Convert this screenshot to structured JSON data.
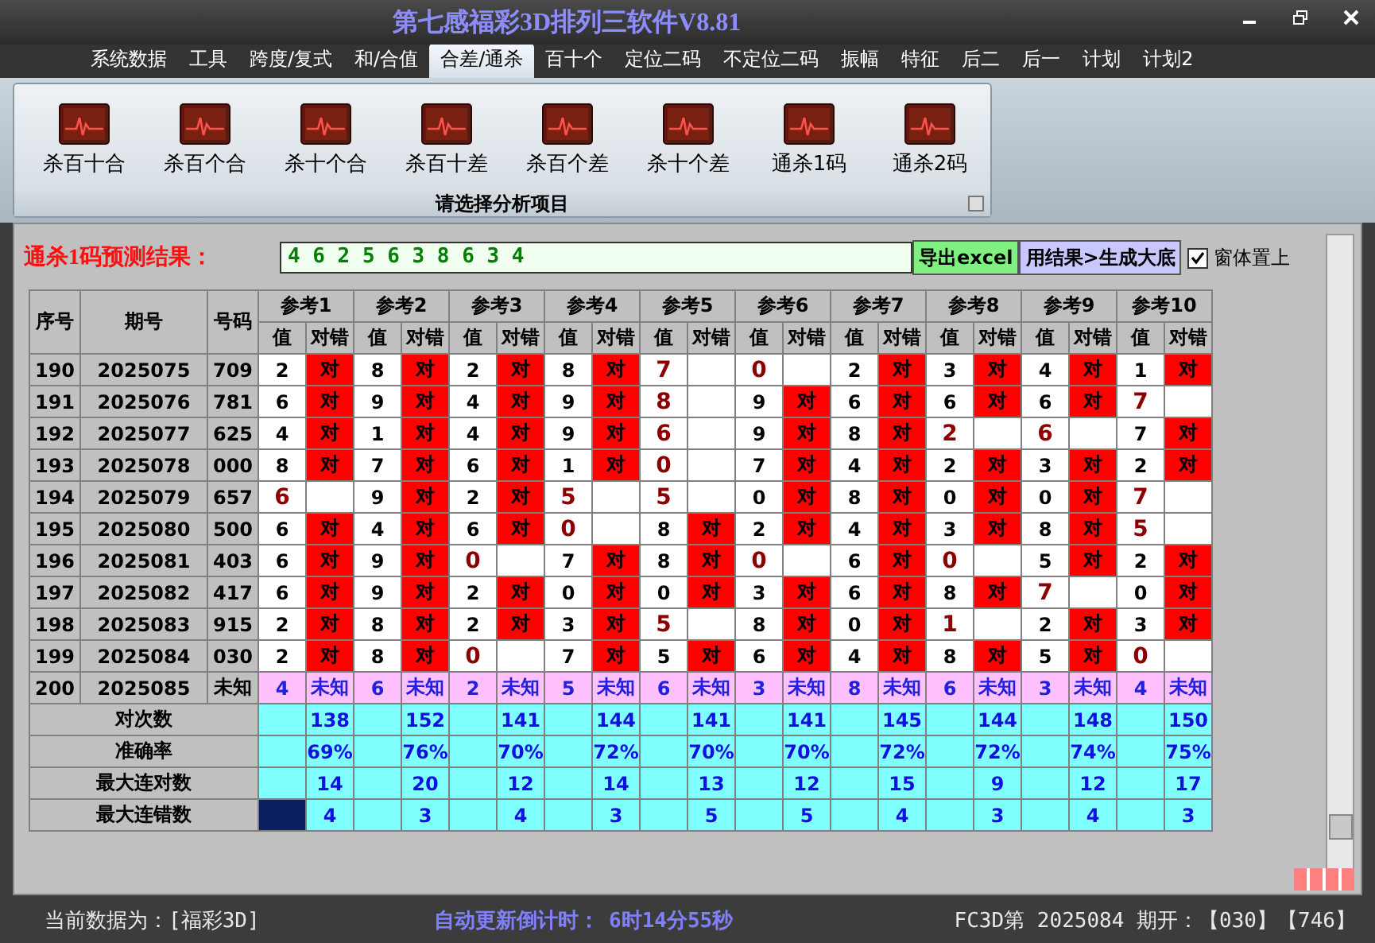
{
  "window": {
    "title": "第七感福彩3D排列三软件V8.81"
  },
  "menu": [
    {
      "label": "系统数据",
      "selected": false
    },
    {
      "label": "工具",
      "selected": false
    },
    {
      "label": "跨度/复式",
      "selected": false
    },
    {
      "label": "和/合值",
      "selected": false
    },
    {
      "label": "合差/通杀",
      "selected": true
    },
    {
      "label": "百十个",
      "selected": false
    },
    {
      "label": "定位二码",
      "selected": false
    },
    {
      "label": "不定位二码",
      "selected": false
    },
    {
      "label": "振幅",
      "selected": false
    },
    {
      "label": "特征",
      "selected": false
    },
    {
      "label": "后二",
      "selected": false
    },
    {
      "label": "后一",
      "selected": false
    },
    {
      "label": "计划",
      "selected": false
    },
    {
      "label": "计划2",
      "selected": false
    }
  ],
  "ribbon": {
    "group_label": "请选择分析项目",
    "items": [
      "杀百十合",
      "杀百个合",
      "杀十个合",
      "杀百十差",
      "杀百个差",
      "杀十个差",
      "通杀1码",
      "通杀2码"
    ]
  },
  "prediction": {
    "label": "通杀1码预测结果：",
    "value": "4 6 2 5 6 3 8 6 3 4",
    "buttons": [
      {
        "label": "导出excel",
        "kind": "export"
      },
      {
        "label": "用结果>生成大底",
        "kind": "generate"
      }
    ],
    "always_on_top": {
      "label": "窗体置上",
      "checked": true
    }
  },
  "table": {
    "columns": [
      "序号",
      "期号",
      "号码"
    ],
    "refs": [
      {
        "label": "参考1",
        "sub": [
          "值",
          "对错"
        ]
      },
      {
        "label": "参考2",
        "sub": [
          "值",
          "对错"
        ]
      },
      {
        "label": "参考3",
        "sub": [
          "值",
          "对错"
        ]
      },
      {
        "label": "参考4",
        "sub": [
          "值",
          "对错"
        ]
      },
      {
        "label": "参考5",
        "sub": [
          "值",
          "对错"
        ]
      },
      {
        "label": "参考6",
        "sub": [
          "值",
          "对错"
        ]
      },
      {
        "label": "参考7",
        "sub": [
          "值",
          "对错"
        ]
      },
      {
        "label": "参考8",
        "sub": [
          "值",
          "对错"
        ]
      },
      {
        "label": "参考9",
        "sub": [
          "值",
          "对错"
        ]
      },
      {
        "label": "参考10",
        "sub": [
          "值",
          "对错"
        ]
      }
    ],
    "rows": [
      {
        "kind": "done",
        "seq": "190",
        "period": "2025075",
        "number": "709",
        "refs": [
          {
            "value": "2",
            "hit": true,
            "mark": "对"
          },
          {
            "value": "8",
            "hit": true,
            "mark": "对"
          },
          {
            "value": "2",
            "hit": true,
            "mark": "对"
          },
          {
            "value": "8",
            "hit": true,
            "mark": "对"
          },
          {
            "value": "7",
            "hit": false
          },
          {
            "value": "0",
            "hit": false
          },
          {
            "value": "2",
            "hit": true,
            "mark": "对"
          },
          {
            "value": "3",
            "hit": true,
            "mark": "对"
          },
          {
            "value": "4",
            "hit": true,
            "mark": "对"
          },
          {
            "value": "1",
            "hit": true,
            "mark": "对"
          }
        ]
      },
      {
        "kind": "done",
        "seq": "191",
        "period": "2025076",
        "number": "781",
        "refs": [
          {
            "value": "6",
            "hit": true,
            "mark": "对"
          },
          {
            "value": "9",
            "hit": true,
            "mark": "对"
          },
          {
            "value": "4",
            "hit": true,
            "mark": "对"
          },
          {
            "value": "9",
            "hit": true,
            "mark": "对"
          },
          {
            "value": "8",
            "hit": false
          },
          {
            "value": "9",
            "hit": true,
            "mark": "对"
          },
          {
            "value": "6",
            "hit": true,
            "mark": "对"
          },
          {
            "value": "6",
            "hit": true,
            "mark": "对"
          },
          {
            "value": "6",
            "hit": true,
            "mark": "对"
          },
          {
            "value": "7",
            "hit": false
          }
        ]
      },
      {
        "kind": "done",
        "seq": "192",
        "period": "2025077",
        "number": "625",
        "refs": [
          {
            "value": "4",
            "hit": true,
            "mark": "对"
          },
          {
            "value": "1",
            "hit": true,
            "mark": "对"
          },
          {
            "value": "4",
            "hit": true,
            "mark": "对"
          },
          {
            "value": "9",
            "hit": true,
            "mark": "对"
          },
          {
            "value": "6",
            "hit": false
          },
          {
            "value": "9",
            "hit": true,
            "mark": "对"
          },
          {
            "value": "8",
            "hit": true,
            "mark": "对"
          },
          {
            "value": "2",
            "hit": false
          },
          {
            "value": "6",
            "hit": false
          },
          {
            "value": "7",
            "hit": true,
            "mark": "对"
          }
        ]
      },
      {
        "kind": "done",
        "seq": "193",
        "period": "2025078",
        "number": "000",
        "refs": [
          {
            "value": "8",
            "hit": true,
            "mark": "对"
          },
          {
            "value": "7",
            "hit": true,
            "mark": "对"
          },
          {
            "value": "6",
            "hit": true,
            "mark": "对"
          },
          {
            "value": "1",
            "hit": true,
            "mark": "对"
          },
          {
            "value": "0",
            "hit": false
          },
          {
            "value": "7",
            "hit": true,
            "mark": "对"
          },
          {
            "value": "4",
            "hit": true,
            "mark": "对"
          },
          {
            "value": "2",
            "hit": true,
            "mark": "对"
          },
          {
            "value": "3",
            "hit": true,
            "mark": "对"
          },
          {
            "value": "2",
            "hit": true,
            "mark": "对"
          }
        ]
      },
      {
        "kind": "done",
        "seq": "194",
        "period": "2025079",
        "number": "657",
        "refs": [
          {
            "value": "6",
            "hit": false
          },
          {
            "value": "9",
            "hit": true,
            "mark": "对"
          },
          {
            "value": "2",
            "hit": true,
            "mark": "对"
          },
          {
            "value": "5",
            "hit": false
          },
          {
            "value": "5",
            "hit": false
          },
          {
            "value": "0",
            "hit": true,
            "mark": "对"
          },
          {
            "value": "8",
            "hit": true,
            "mark": "对"
          },
          {
            "value": "0",
            "hit": true,
            "mark": "对"
          },
          {
            "value": "0",
            "hit": true,
            "mark": "对"
          },
          {
            "value": "7",
            "hit": false
          }
        ]
      },
      {
        "kind": "done",
        "seq": "195",
        "period": "2025080",
        "number": "500",
        "refs": [
          {
            "value": "6",
            "hit": true,
            "mark": "对"
          },
          {
            "value": "4",
            "hit": true,
            "mark": "对"
          },
          {
            "value": "6",
            "hit": true,
            "mark": "对"
          },
          {
            "value": "0",
            "hit": false
          },
          {
            "value": "8",
            "hit": true,
            "mark": "对"
          },
          {
            "value": "2",
            "hit": true,
            "mark": "对"
          },
          {
            "value": "4",
            "hit": true,
            "mark": "对"
          },
          {
            "value": "3",
            "hit": true,
            "mark": "对"
          },
          {
            "value": "8",
            "hit": true,
            "mark": "对"
          },
          {
            "value": "5",
            "hit": false
          }
        ]
      },
      {
        "kind": "done",
        "seq": "196",
        "period": "2025081",
        "number": "403",
        "refs": [
          {
            "value": "6",
            "hit": true,
            "mark": "对"
          },
          {
            "value": "9",
            "hit": true,
            "mark": "对"
          },
          {
            "value": "0",
            "hit": false
          },
          {
            "value": "7",
            "hit": true,
            "mark": "对"
          },
          {
            "value": "8",
            "hit": true,
            "mark": "对"
          },
          {
            "value": "0",
            "hit": false
          },
          {
            "value": "6",
            "hit": true,
            "mark": "对"
          },
          {
            "value": "0",
            "hit": false
          },
          {
            "value": "5",
            "hit": true,
            "mark": "对"
          },
          {
            "value": "2",
            "hit": true,
            "mark": "对"
          }
        ]
      },
      {
        "kind": "done",
        "seq": "197",
        "period": "2025082",
        "number": "417",
        "refs": [
          {
            "value": "6",
            "hit": true,
            "mark": "对"
          },
          {
            "value": "9",
            "hit": true,
            "mark": "对"
          },
          {
            "value": "2",
            "hit": true,
            "mark": "对"
          },
          {
            "value": "0",
            "hit": true,
            "mark": "对"
          },
          {
            "value": "0",
            "hit": true,
            "mark": "对"
          },
          {
            "value": "3",
            "hit": true,
            "mark": "对"
          },
          {
            "value": "6",
            "hit": true,
            "mark": "对"
          },
          {
            "value": "8",
            "hit": true,
            "mark": "对"
          },
          {
            "value": "7",
            "hit": false
          },
          {
            "value": "0",
            "hit": true,
            "mark": "对"
          }
        ]
      },
      {
        "kind": "done",
        "seq": "198",
        "period": "2025083",
        "number": "915",
        "refs": [
          {
            "value": "2",
            "hit": true,
            "mark": "对"
          },
          {
            "value": "8",
            "hit": true,
            "mark": "对"
          },
          {
            "value": "2",
            "hit": true,
            "mark": "对"
          },
          {
            "value": "3",
            "hit": true,
            "mark": "对"
          },
          {
            "value": "5",
            "hit": false
          },
          {
            "value": "8",
            "hit": true,
            "mark": "对"
          },
          {
            "value": "0",
            "hit": true,
            "mark": "对"
          },
          {
            "value": "1",
            "hit": false
          },
          {
            "value": "2",
            "hit": true,
            "mark": "对"
          },
          {
            "value": "3",
            "hit": true,
            "mark": "对"
          }
        ]
      },
      {
        "kind": "done",
        "seq": "199",
        "period": "2025084",
        "number": "030",
        "refs": [
          {
            "value": "2",
            "hit": true,
            "mark": "对"
          },
          {
            "value": "8",
            "hit": true,
            "mark": "对"
          },
          {
            "value": "0",
            "hit": false
          },
          {
            "value": "7",
            "hit": true,
            "mark": "对"
          },
          {
            "value": "5",
            "hit": true,
            "mark": "对"
          },
          {
            "value": "6",
            "hit": true,
            "mark": "对"
          },
          {
            "value": "4",
            "hit": true,
            "mark": "对"
          },
          {
            "value": "8",
            "hit": true,
            "mark": "对"
          },
          {
            "value": "5",
            "hit": true,
            "mark": "对"
          },
          {
            "value": "0",
            "hit": false
          }
        ]
      },
      {
        "kind": "pending",
        "seq": "200",
        "period": "2025085",
        "number": "未知",
        "refs": [
          {
            "value": "4",
            "mark": "未知"
          },
          {
            "value": "6",
            "mark": "未知"
          },
          {
            "value": "2",
            "mark": "未知"
          },
          {
            "value": "5",
            "mark": "未知"
          },
          {
            "value": "6",
            "mark": "未知"
          },
          {
            "value": "3",
            "mark": "未知"
          },
          {
            "value": "8",
            "mark": "未知"
          },
          {
            "value": "6",
            "mark": "未知"
          },
          {
            "value": "3",
            "mark": "未知"
          },
          {
            "value": "4",
            "mark": "未知"
          }
        ]
      }
    ],
    "stats": [
      {
        "label": "对次数",
        "selected": false,
        "values": [
          "138",
          "152",
          "141",
          "144",
          "141",
          "141",
          "145",
          "144",
          "148",
          "150"
        ]
      },
      {
        "label": "准确率",
        "selected": false,
        "values": [
          "69%",
          "76%",
          "70%",
          "72%",
          "70%",
          "70%",
          "72%",
          "72%",
          "74%",
          "75%"
        ]
      },
      {
        "label": "最大连对数",
        "selected": false,
        "values": [
          "14",
          "20",
          "12",
          "14",
          "13",
          "12",
          "15",
          "9",
          "12",
          "17"
        ]
      },
      {
        "label": "最大连错数",
        "selected": true,
        "values": [
          "4",
          "3",
          "4",
          "3",
          "5",
          "5",
          "4",
          "3",
          "4",
          "3"
        ]
      }
    ]
  },
  "status_bar": {
    "current_data": "当前数据为：[福彩3D]",
    "countdown_label": "自动更新倒计时：",
    "countdown": "6时14分55秒",
    "draw_info": "FC3D第 2025084 期开：【030】【746】"
  }
}
